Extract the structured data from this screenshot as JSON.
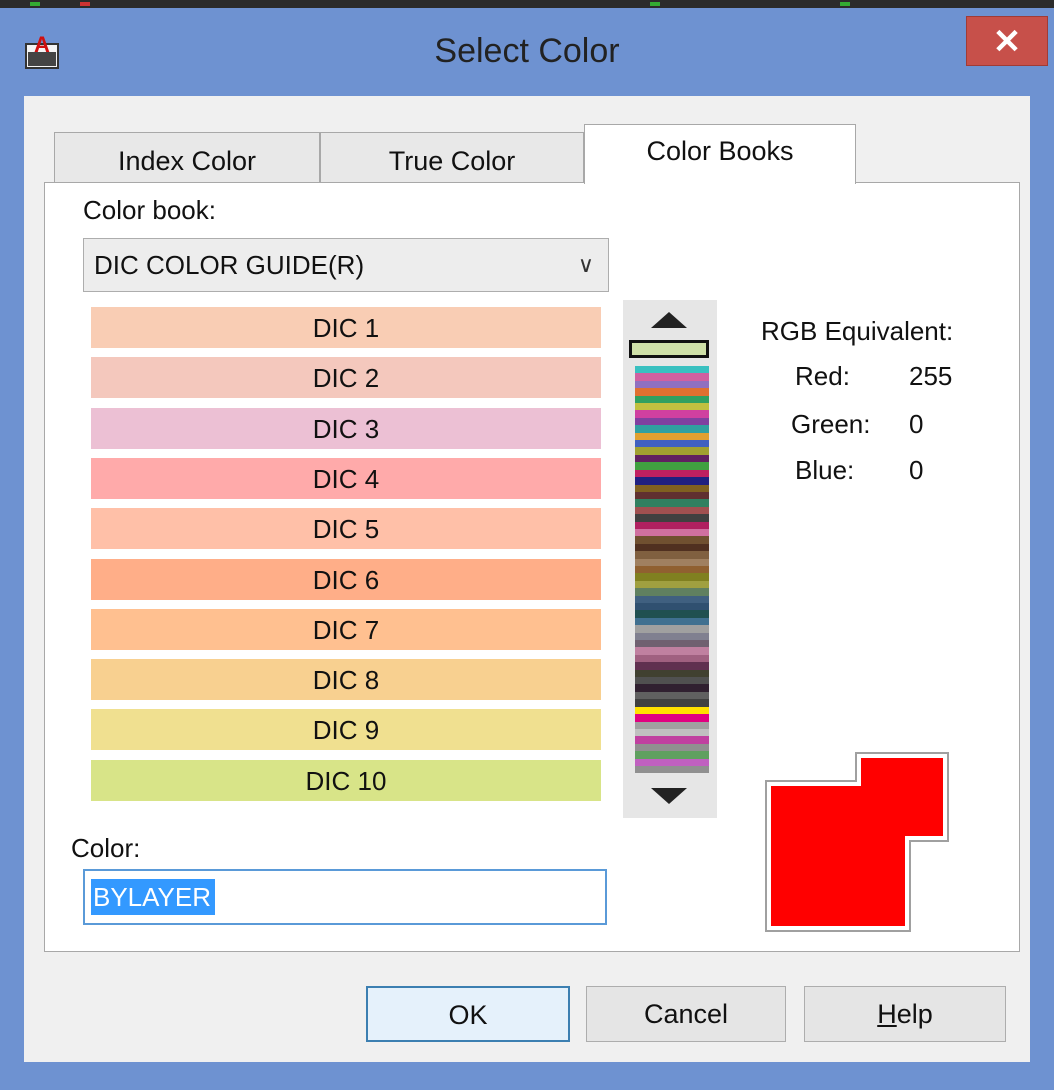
{
  "window": {
    "title": "Select Color",
    "close_glyph": "✕",
    "app_icon": "autocad-a-icon"
  },
  "tabs": [
    {
      "label": "Index Color",
      "active": false
    },
    {
      "label": "True Color",
      "active": false
    },
    {
      "label": "Color Books",
      "active": true
    }
  ],
  "color_book": {
    "label": "Color book:",
    "selected": "DIC COLOR GUIDE(R)"
  },
  "colors": [
    {
      "label": "DIC 1",
      "hex": "#f9cdb4"
    },
    {
      "label": "DIC 2",
      "hex": "#f4c8bd"
    },
    {
      "label": "DIC 3",
      "hex": "#ecc0d4"
    },
    {
      "label": "DIC 4",
      "hex": "#ffaaaa"
    },
    {
      "label": "DIC 5",
      "hex": "#ffc0a8"
    },
    {
      "label": "DIC 6",
      "hex": "#ffae88"
    },
    {
      "label": "DIC 7",
      "hex": "#ffc090"
    },
    {
      "label": "DIC 8",
      "hex": "#f8d090"
    },
    {
      "label": "DIC 9",
      "hex": "#f0e090"
    },
    {
      "label": "DIC 10",
      "hex": "#d8e488"
    }
  ],
  "rgb": {
    "title": "RGB Equivalent:",
    "red_label": "Red:",
    "red": "255",
    "green_label": "Green:",
    "green": "0",
    "blue_label": "Blue:",
    "blue": "0"
  },
  "color_field": {
    "label": "Color:",
    "value": "BYLAYER"
  },
  "preview": {
    "current": "#ff0000",
    "original": "#ff0000"
  },
  "buttons": {
    "ok": "OK",
    "cancel": "Cancel",
    "help_first": "H",
    "help_rest": "elp"
  },
  "strip_colors": [
    "#39c0c0",
    "#d060a0",
    "#9070c0",
    "#e07030",
    "#30a060",
    "#c0c040",
    "#d040a0",
    "#8040a0",
    "#30a0a0",
    "#e0a030",
    "#4060c0",
    "#a0a030",
    "#602060",
    "#40a040",
    "#c02060",
    "#202080",
    "#806020",
    "#603030",
    "#308060",
    "#a05050",
    "#404040",
    "#b02060",
    "#d070a0",
    "#705030",
    "#503020",
    "#806040",
    "#a08060",
    "#906030",
    "#808020",
    "#a0a040",
    "#608060",
    "#406080",
    "#305070",
    "#205050",
    "#407090",
    "#a0a0a0",
    "#808090",
    "#706070",
    "#c080a0",
    "#a06080",
    "#603050",
    "#404030",
    "#505050",
    "#302030",
    "#606060",
    "#404040",
    "#ffe000",
    "#e00080",
    "#a0a0a0",
    "#c0c0c0",
    "#c040a0",
    "#909090",
    "#60a060",
    "#c060c0",
    "#909090"
  ]
}
